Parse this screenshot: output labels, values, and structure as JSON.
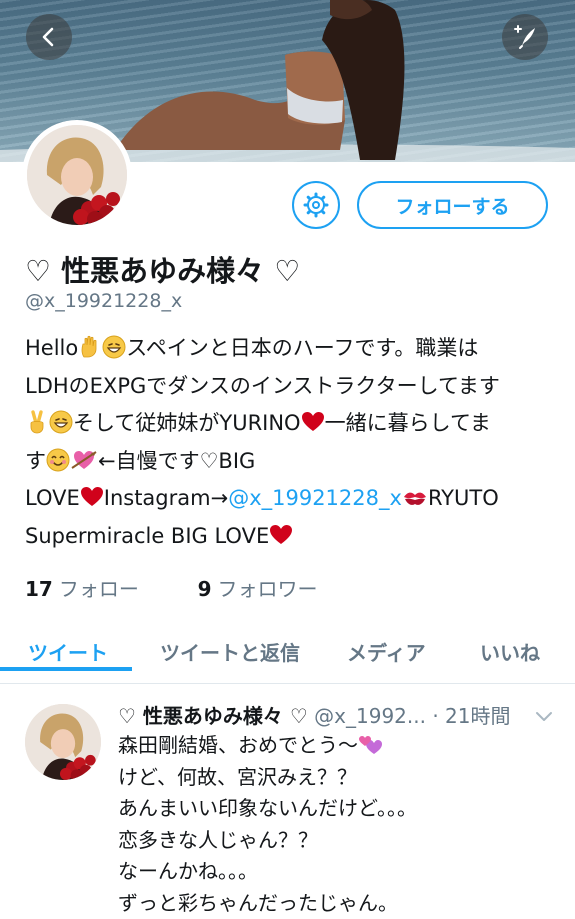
{
  "nav": {
    "back_icon": "chevron-left-icon",
    "compose_icon": "compose-feather-icon"
  },
  "profile": {
    "settings_icon": "gear-icon",
    "follow_label": "フォローする",
    "name": "♡ 性悪あゆみ様々 ♡",
    "handle": "@x_19921228_x",
    "bio": {
      "l1a": "Hello",
      "l1b": "スペインと日本のハーフです。職業は",
      "l2": "LDHのEXPGでダンスのインストラクターしてます",
      "l3a": "そして従姉妹がYURINO",
      "l3b": "一緒に暮らしてま",
      "l4a": "す",
      "l4b": "←自慢です♡BIG",
      "l5a": "LOVE",
      "l5b": "Instagram→",
      "l5c": "@x_19921228_x",
      "l5d": "RYUTO",
      "l6": "Supermiracle BIG LOVE"
    },
    "following_count": "17",
    "following_label": "フォロー",
    "followers_count": "9",
    "followers_label": "フォロワー"
  },
  "tabs": [
    "ツイート",
    "ツイートと返信",
    "メディア",
    "いいね"
  ],
  "tweet": {
    "name": "♡ 性悪あゆみ様々 ♡",
    "handle": "@x_1992...",
    "time": "· 21時間",
    "lines": [
      "森田剛結婚、おめでとう〜",
      "けど、何故、宮沢みえ？？",
      "あんまいい印象ないんだけど。。。",
      "恋多きな人じゃん？？",
      "なーんかね。。。",
      "ずっと彩ちゃんだったじゃん。"
    ]
  },
  "colors": {
    "accent": "#1da1f2",
    "secondary_text": "#657786",
    "text": "#14171a",
    "heart": "#d0021b"
  }
}
